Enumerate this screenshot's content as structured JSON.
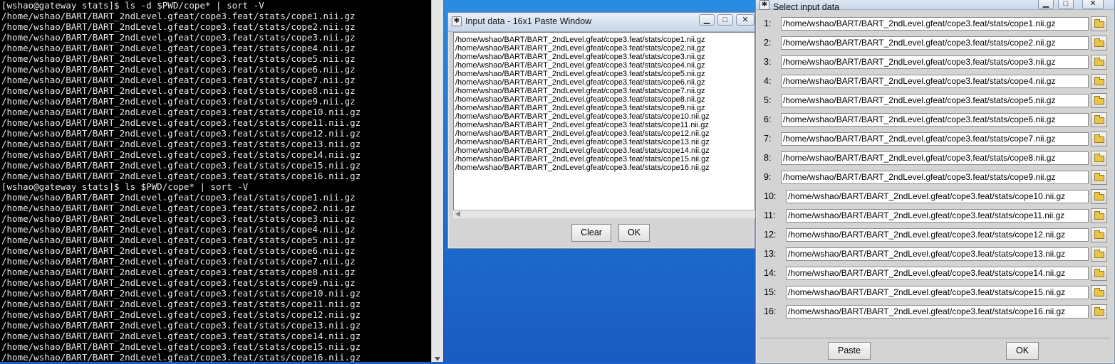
{
  "terminal": {
    "lines": [
      "[wshao@gateway stats]$ ls -d $PWD/cope* | sort -V",
      "/home/wshao/BART/BART_2ndLevel.gfeat/cope3.feat/stats/cope1.nii.gz",
      "/home/wshao/BART/BART_2ndLevel.gfeat/cope3.feat/stats/cope2.nii.gz",
      "/home/wshao/BART/BART_2ndLevel.gfeat/cope3.feat/stats/cope3.nii.gz",
      "/home/wshao/BART/BART_2ndLevel.gfeat/cope3.feat/stats/cope4.nii.gz",
      "/home/wshao/BART/BART_2ndLevel.gfeat/cope3.feat/stats/cope5.nii.gz",
      "/home/wshao/BART/BART_2ndLevel.gfeat/cope3.feat/stats/cope6.nii.gz",
      "/home/wshao/BART/BART_2ndLevel.gfeat/cope3.feat/stats/cope7.nii.gz",
      "/home/wshao/BART/BART_2ndLevel.gfeat/cope3.feat/stats/cope8.nii.gz",
      "/home/wshao/BART/BART_2ndLevel.gfeat/cope3.feat/stats/cope9.nii.gz",
      "/home/wshao/BART/BART_2ndLevel.gfeat/cope3.feat/stats/cope10.nii.gz",
      "/home/wshao/BART/BART_2ndLevel.gfeat/cope3.feat/stats/cope11.nii.gz",
      "/home/wshao/BART/BART_2ndLevel.gfeat/cope3.feat/stats/cope12.nii.gz",
      "/home/wshao/BART/BART_2ndLevel.gfeat/cope3.feat/stats/cope13.nii.gz",
      "/home/wshao/BART/BART_2ndLevel.gfeat/cope3.feat/stats/cope14.nii.gz",
      "/home/wshao/BART/BART_2ndLevel.gfeat/cope3.feat/stats/cope15.nii.gz",
      "/home/wshao/BART/BART_2ndLevel.gfeat/cope3.feat/stats/cope16.nii.gz",
      "[wshao@gateway stats]$ ls $PWD/cope* | sort -V",
      "/home/wshao/BART/BART_2ndLevel.gfeat/cope3.feat/stats/cope1.nii.gz",
      "/home/wshao/BART/BART_2ndLevel.gfeat/cope3.feat/stats/cope2.nii.gz",
      "/home/wshao/BART/BART_2ndLevel.gfeat/cope3.feat/stats/cope3.nii.gz",
      "/home/wshao/BART/BART_2ndLevel.gfeat/cope3.feat/stats/cope4.nii.gz",
      "/home/wshao/BART/BART_2ndLevel.gfeat/cope3.feat/stats/cope5.nii.gz",
      "/home/wshao/BART/BART_2ndLevel.gfeat/cope3.feat/stats/cope6.nii.gz",
      "/home/wshao/BART/BART_2ndLevel.gfeat/cope3.feat/stats/cope7.nii.gz",
      "/home/wshao/BART/BART_2ndLevel.gfeat/cope3.feat/stats/cope8.nii.gz",
      "/home/wshao/BART/BART_2ndLevel.gfeat/cope3.feat/stats/cope9.nii.gz",
      "/home/wshao/BART/BART_2ndLevel.gfeat/cope3.feat/stats/cope10.nii.gz",
      "/home/wshao/BART/BART_2ndLevel.gfeat/cope3.feat/stats/cope11.nii.gz",
      "/home/wshao/BART/BART_2ndLevel.gfeat/cope3.feat/stats/cope12.nii.gz",
      "/home/wshao/BART/BART_2ndLevel.gfeat/cope3.feat/stats/cope13.nii.gz",
      "/home/wshao/BART/BART_2ndLevel.gfeat/cope3.feat/stats/cope14.nii.gz",
      "/home/wshao/BART/BART_2ndLevel.gfeat/cope3.feat/stats/cope15.nii.gz",
      "/home/wshao/BART/BART_2ndLevel.gfeat/cope3.feat/stats/cope16.nii.gz"
    ]
  },
  "paste_window": {
    "title": "Input data - 16x1 Paste Window",
    "lines": [
      "/home/wshao/BART/BART_2ndLevel.gfeat/cope3.feat/stats/cope1.nii.gz",
      "/home/wshao/BART/BART_2ndLevel.gfeat/cope3.feat/stats/cope2.nii.gz",
      "/home/wshao/BART/BART_2ndLevel.gfeat/cope3.feat/stats/cope3.nii.gz",
      "/home/wshao/BART/BART_2ndLevel.gfeat/cope3.feat/stats/cope4.nii.gz",
      "/home/wshao/BART/BART_2ndLevel.gfeat/cope3.feat/stats/cope5.nii.gz",
      "/home/wshao/BART/BART_2ndLevel.gfeat/cope3.feat/stats/cope6.nii.gz",
      "/home/wshao/BART/BART_2ndLevel.gfeat/cope3.feat/stats/cope7.nii.gz",
      "/home/wshao/BART/BART_2ndLevel.gfeat/cope3.feat/stats/cope8.nii.gz",
      "/home/wshao/BART/BART_2ndLevel.gfeat/cope3.feat/stats/cope9.nii.gz",
      "/home/wshao/BART/BART_2ndLevel.gfeat/cope3.feat/stats/cope10.nii.gz",
      "/home/wshao/BART/BART_2ndLevel.gfeat/cope3.feat/stats/cope11.nii.gz",
      "/home/wshao/BART/BART_2ndLevel.gfeat/cope3.feat/stats/cope12.nii.gz",
      "/home/wshao/BART/BART_2ndLevel.gfeat/cope3.feat/stats/cope13.nii.gz",
      "/home/wshao/BART/BART_2ndLevel.gfeat/cope3.feat/stats/cope14.nii.gz",
      "/home/wshao/BART/BART_2ndLevel.gfeat/cope3.feat/stats/cope15.nii.gz",
      "/home/wshao/BART/BART_2ndLevel.gfeat/cope3.feat/stats/cope16.nii.gz"
    ],
    "clear_label": "Clear",
    "ok_label": "OK"
  },
  "select_window": {
    "title": "Select input data",
    "rows": [
      {
        "num": "1:",
        "value": "/home/wshao/BART/BART_2ndLevel.gfeat/cope3.feat/stats/cope1.nii.gz"
      },
      {
        "num": "2:",
        "value": "/home/wshao/BART/BART_2ndLevel.gfeat/cope3.feat/stats/cope2.nii.gz"
      },
      {
        "num": "3:",
        "value": "/home/wshao/BART/BART_2ndLevel.gfeat/cope3.feat/stats/cope3.nii.gz"
      },
      {
        "num": "4:",
        "value": "/home/wshao/BART/BART_2ndLevel.gfeat/cope3.feat/stats/cope4.nii.gz"
      },
      {
        "num": "5:",
        "value": "/home/wshao/BART/BART_2ndLevel.gfeat/cope3.feat/stats/cope5.nii.gz"
      },
      {
        "num": "6:",
        "value": "/home/wshao/BART/BART_2ndLevel.gfeat/cope3.feat/stats/cope6.nii.gz"
      },
      {
        "num": "7:",
        "value": "/home/wshao/BART/BART_2ndLevel.gfeat/cope3.feat/stats/cope7.nii.gz"
      },
      {
        "num": "8:",
        "value": "/home/wshao/BART/BART_2ndLevel.gfeat/cope3.feat/stats/cope8.nii.gz"
      },
      {
        "num": "9:",
        "value": "/home/wshao/BART/BART_2ndLevel.gfeat/cope3.feat/stats/cope9.nii.gz"
      },
      {
        "num": "10:",
        "value": "/home/wshao/BART/BART_2ndLevel.gfeat/cope3.feat/stats/cope10.nii.gz"
      },
      {
        "num": "11:",
        "value": "/home/wshao/BART/BART_2ndLevel.gfeat/cope3.feat/stats/cope11.nii.gz"
      },
      {
        "num": "12:",
        "value": "/home/wshao/BART/BART_2ndLevel.gfeat/cope3.feat/stats/cope12.nii.gz"
      },
      {
        "num": "13:",
        "value": "/home/wshao/BART/BART_2ndLevel.gfeat/cope3.feat/stats/cope13.nii.gz"
      },
      {
        "num": "14:",
        "value": "/home/wshao/BART/BART_2ndLevel.gfeat/cope3.feat/stats/cope14.nii.gz"
      },
      {
        "num": "15:",
        "value": "/home/wshao/BART/BART_2ndLevel.gfeat/cope3.feat/stats/cope15.nii.gz"
      },
      {
        "num": "16:",
        "value": "/home/wshao/BART/BART_2ndLevel.gfeat/cope3.feat/stats/cope16.nii.gz"
      }
    ],
    "paste_label": "Paste",
    "ok_label": "OK"
  },
  "colors": {
    "terminal_bg": "#000000",
    "terminal_fg": "#e8e8e8",
    "desktop_blue": "#1f6fd1",
    "window_gray": "#d4d4d4"
  }
}
